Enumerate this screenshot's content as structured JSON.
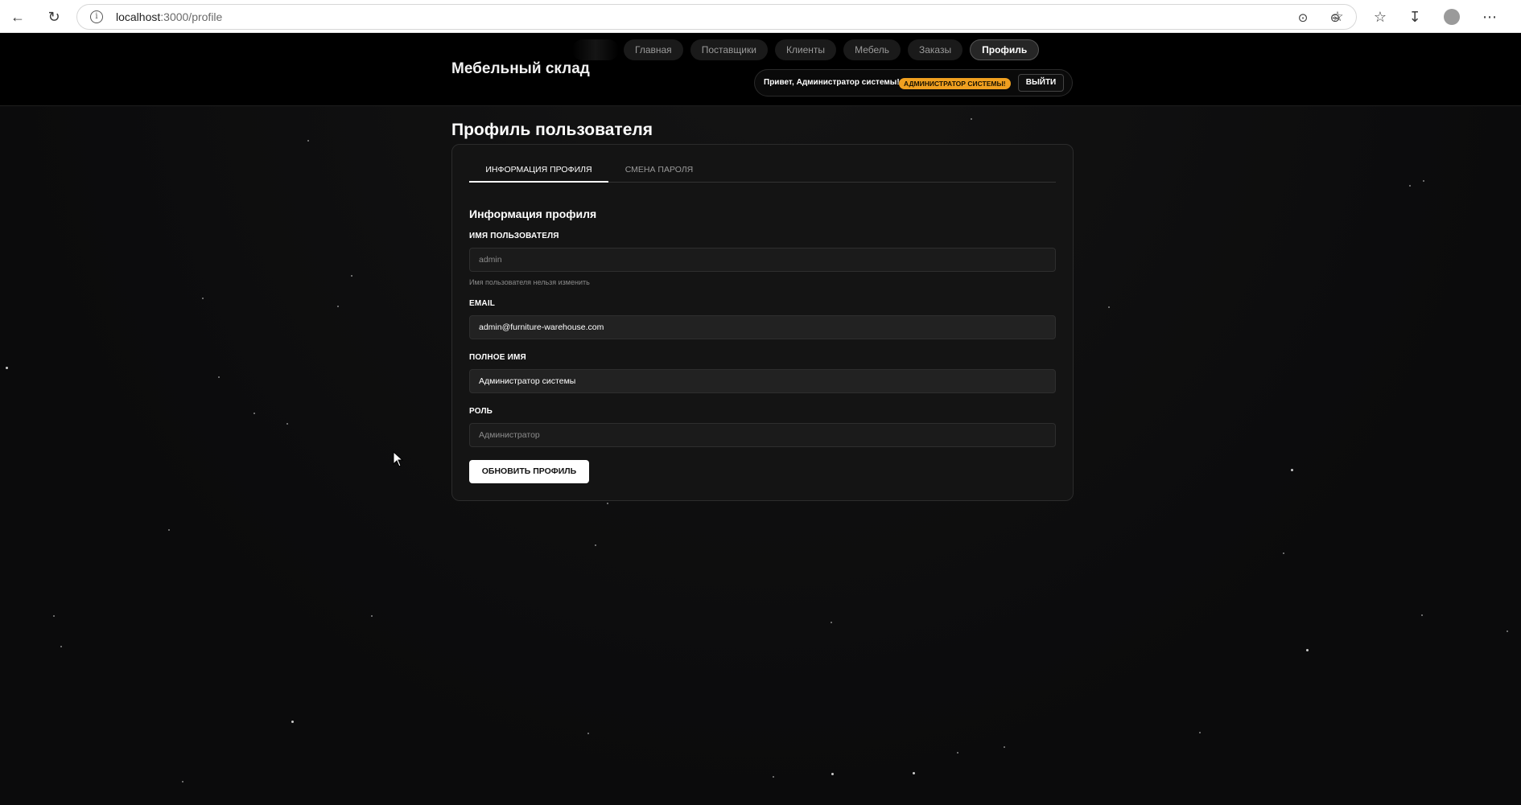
{
  "browser": {
    "url_host": "localhost",
    "url_path": ":3000/profile"
  },
  "header": {
    "brand": "Мебельный склад",
    "nav": [
      "Главная",
      "Поставщики",
      "Клиенты",
      "Мебель",
      "Заказы",
      "Профиль"
    ],
    "active_nav": "Профиль",
    "greeting": "Привет, Администратор системы!",
    "role_badge": "АДМИНИСТРАТОР СИСТЕМЫ!",
    "logout": "ВЫЙТИ"
  },
  "main": {
    "title": "Профиль пользователя",
    "tabs": [
      "ИНФОРМАЦИЯ ПРОФИЛЯ",
      "СМЕНА ПАРОЛЯ"
    ],
    "section_title": "Информация профиля",
    "fields": {
      "username": {
        "label": "ИМЯ ПОЛЬЗОВАТЕЛЯ",
        "value": "admin",
        "hint": "Имя пользователя нельзя изменить"
      },
      "email": {
        "label": "EMAIL",
        "value": "admin@furniture-warehouse.com"
      },
      "full_name": {
        "label": "ПОЛНОЕ ИМЯ",
        "value": "Администратор системы"
      },
      "role": {
        "label": "РОЛЬ",
        "value": "Администратор"
      }
    },
    "submit": "ОБНОВИТЬ ПРОФИЛЬ"
  },
  "colors": {
    "background": "#0c0c0d",
    "header": "#000000",
    "badge": "#f0a020",
    "card": "#141414"
  }
}
